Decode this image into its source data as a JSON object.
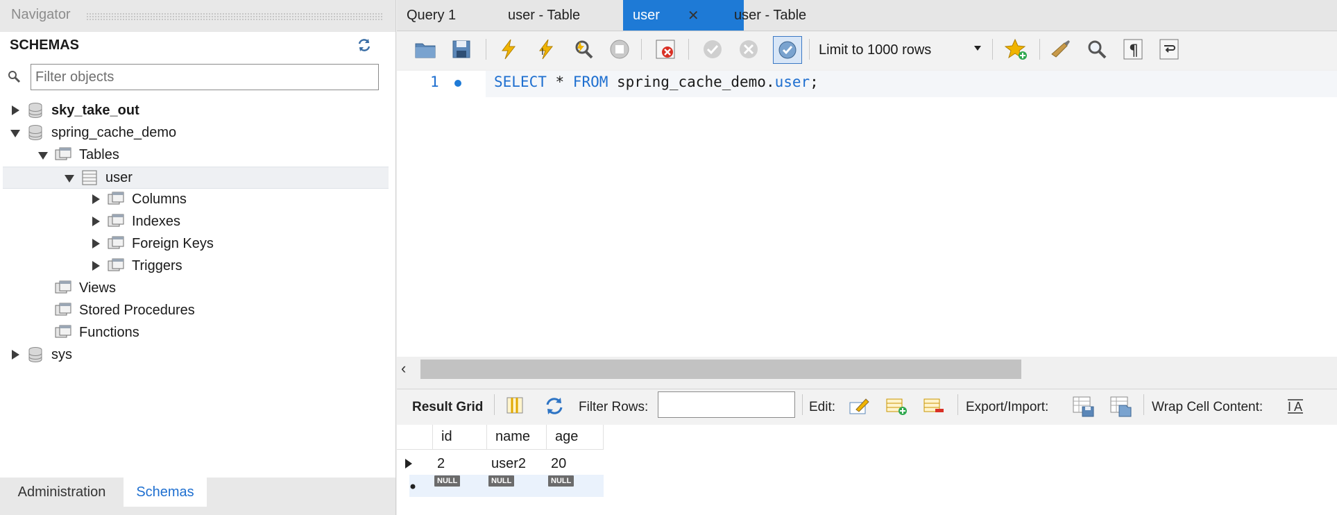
{
  "navigator": {
    "title": "Navigator",
    "schemas_label": "SCHEMAS",
    "filter_placeholder": "Filter objects",
    "tree": {
      "sky_take_out": "sky_take_out",
      "spring_cache_demo": "spring_cache_demo",
      "tables": "Tables",
      "user": "user",
      "columns": "Columns",
      "indexes": "Indexes",
      "foreign_keys": "Foreign Keys",
      "triggers": "Triggers",
      "views": "Views",
      "stored_procedures": "Stored Procedures",
      "functions": "Functions",
      "sys": "sys"
    },
    "bottom_tabs": {
      "administration": "Administration",
      "schemas": "Schemas"
    }
  },
  "query_tabs": [
    {
      "label": "Query 1"
    },
    {
      "label": "user - Table"
    },
    {
      "label": "user",
      "close": "✕"
    },
    {
      "label": "user - Table"
    }
  ],
  "toolbar": {
    "limit_select": "Limit to 1000 rows"
  },
  "editor": {
    "line_number": "1",
    "sql": {
      "select": "SELECT",
      "star": " * ",
      "from": "FROM",
      "target": " spring_cache_demo.",
      "table": "user",
      "end": ";"
    }
  },
  "result_bar": {
    "result_grid": "Result Grid",
    "filter_rows": "Filter Rows:",
    "edit": "Edit:",
    "export_import": "Export/Import:",
    "wrap_cell_content": "Wrap Cell Content:"
  },
  "grid": {
    "columns": [
      "id",
      "name",
      "age"
    ],
    "rows": [
      [
        "2",
        "user2",
        "20"
      ]
    ],
    "null_label": "NULL"
  },
  "colors": {
    "accent": "#1e7ad6",
    "keyword": "#1e6fd0",
    "null_badge": "#6b6b6b"
  },
  "icons": [
    "refresh-icon",
    "search-icon",
    "database-icon",
    "folder-icon",
    "table-icon",
    "open-file-icon",
    "save-icon",
    "execute-icon",
    "execute-current-icon",
    "explain-icon",
    "stop-icon",
    "toggle-error-icon",
    "commit-icon",
    "rollback-icon",
    "autocommit-icon",
    "bookmark-icon",
    "beautify-icon",
    "find-icon",
    "invisible-chars-icon",
    "wrap-icon",
    "form-editor-icon",
    "refresh-grid-icon",
    "edit-row-icon",
    "add-row-icon",
    "delete-row-icon",
    "export-icon",
    "import-icon",
    "wrap-cell-icon"
  ]
}
